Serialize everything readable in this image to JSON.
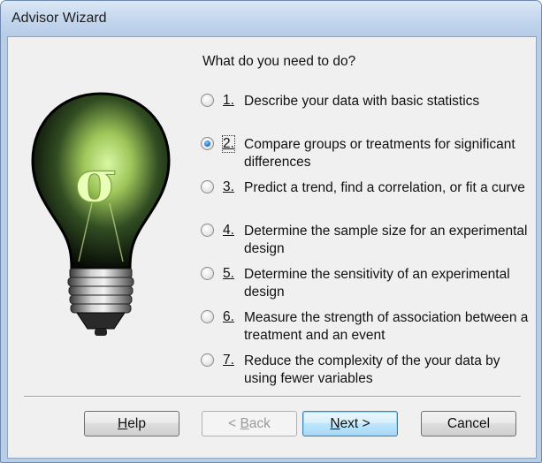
{
  "window": {
    "title": "Advisor Wizard"
  },
  "question": "What do you need to do?",
  "options": [
    {
      "number": "1.",
      "label": "Describe your data with basic statistics",
      "checked": false
    },
    {
      "number": "2.",
      "label": "Compare groups or treatments for significant differences",
      "checked": true
    },
    {
      "number": "3.",
      "label": "Predict a trend, find a correlation, or fit a curve",
      "checked": false
    },
    {
      "number": "4.",
      "label": "Determine the sample size for an experimental design",
      "checked": false
    },
    {
      "number": "5.",
      "label": "Determine the sensitivity of an experimental design",
      "checked": false
    },
    {
      "number": "6.",
      "label": "Measure the strength of association between a treatment and an event",
      "checked": false
    },
    {
      "number": "7.",
      "label": "Reduce the complexity of the your data by using fewer variables",
      "checked": false
    }
  ],
  "illustration": {
    "icon": "lightbulb-sigma-icon",
    "symbol": "σ"
  },
  "buttons": {
    "help": {
      "mnemonic": "H",
      "rest": "elp"
    },
    "back": {
      "arrow": "<",
      "mnemonic": "B",
      "rest": "ack"
    },
    "next": {
      "mnemonic": "N",
      "rest": "ext",
      "arrow": ">"
    },
    "cancel": "Cancel"
  },
  "colors": {
    "frame": "#b9cde5",
    "client": "#f0f0f0",
    "bulb_glow": "#d8f59a",
    "radio_checked": "#2a7fd4"
  }
}
